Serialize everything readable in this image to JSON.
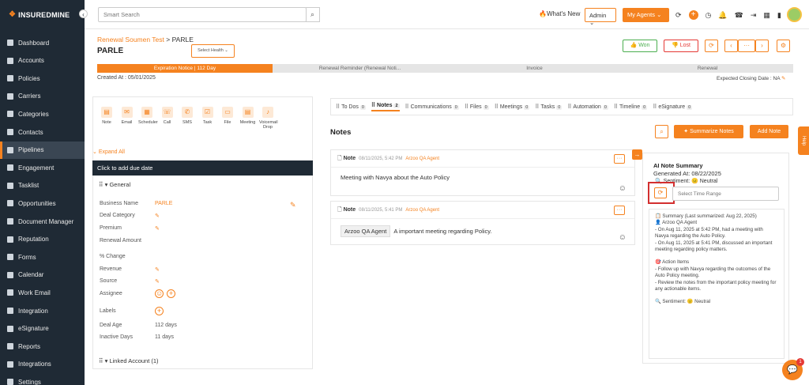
{
  "brand": {
    "name": "INSUREDMINE",
    "accent": "#f5821f"
  },
  "sidebar": {
    "items": [
      {
        "label": "Dashboard",
        "icon": "dashboard-icon"
      },
      {
        "label": "Accounts",
        "icon": "accounts-icon"
      },
      {
        "label": "Policies",
        "icon": "policies-icon"
      },
      {
        "label": "Carriers",
        "icon": "carriers-icon"
      },
      {
        "label": "Categories",
        "icon": "categories-icon"
      },
      {
        "label": "Contacts",
        "icon": "contacts-icon"
      },
      {
        "label": "Pipelines",
        "icon": "pipelines-icon",
        "active": true
      },
      {
        "label": "Engagement",
        "icon": "engagement-icon"
      },
      {
        "label": "Tasklist",
        "icon": "tasklist-icon"
      },
      {
        "label": "Opportunities",
        "icon": "opportunities-icon"
      },
      {
        "label": "Document Manager",
        "icon": "document-icon"
      },
      {
        "label": "Reputation",
        "icon": "reputation-icon"
      },
      {
        "label": "Forms",
        "icon": "forms-icon"
      },
      {
        "label": "Calendar",
        "icon": "calendar-icon"
      },
      {
        "label": "Work Email",
        "icon": "email-icon"
      },
      {
        "label": "Integration",
        "icon": "integration-icon"
      },
      {
        "label": "eSignature",
        "icon": "esignature-icon"
      },
      {
        "label": "Reports",
        "icon": "reports-icon"
      },
      {
        "label": "Integrations",
        "icon": "integrations-icon"
      },
      {
        "label": "Settings",
        "icon": "settings-icon"
      }
    ]
  },
  "topbar": {
    "search_placeholder": "Smart Search",
    "whats_new": "What's New",
    "admin": "Admin",
    "my_agents": "My Agents"
  },
  "header": {
    "breadcrumb_link": "Renewal Soumen Test",
    "breadcrumb_sep": ">",
    "breadcrumb_current": "PARLE",
    "title": "PARLE",
    "select_health": "Select Health",
    "won": "Won",
    "lost": "Lost"
  },
  "stages": [
    "Expiration Notice | 112 Day",
    "Renewal Reminder (Renewal Noti...",
    "Invoice",
    "Renewal"
  ],
  "created": "Created At : 05/01/2025",
  "closing": "Expected Closing Date : NA",
  "actions": [
    "Note",
    "Email",
    "Scheduler",
    "Call",
    "SMS",
    "Task",
    "File",
    "Meeting",
    "Voicemail Drop"
  ],
  "left": {
    "expand_all": "Expand All",
    "due_date": "Click to add due date",
    "general": "General",
    "linked_account": "Linked Account (1)",
    "fields": [
      {
        "label": "Business Name",
        "value": "PARLE"
      },
      {
        "label": "Deal Category",
        "value": ""
      },
      {
        "label": "Premium",
        "value": ""
      },
      {
        "label": "Renewal Amount",
        "value": ""
      },
      {
        "label": "% Change",
        "value": ""
      },
      {
        "label": "Revenue",
        "value": ""
      },
      {
        "label": "Source",
        "value": ""
      },
      {
        "label": "Assignee",
        "value": ""
      },
      {
        "label": "Labels",
        "value": ""
      },
      {
        "label": "Deal Age",
        "value": "112 days"
      },
      {
        "label": "Inactive Days",
        "value": "11 days"
      }
    ]
  },
  "tabs": [
    {
      "label": "To Dos",
      "count": "0"
    },
    {
      "label": "Notes",
      "count": "2"
    },
    {
      "label": "Communications",
      "count": "0"
    },
    {
      "label": "Files",
      "count": "0"
    },
    {
      "label": "Meetings",
      "count": "0"
    },
    {
      "label": "Tasks",
      "count": "0"
    },
    {
      "label": "Automation",
      "count": "0"
    },
    {
      "label": "Timeline",
      "count": "0"
    },
    {
      "label": "eSignature",
      "count": "0"
    }
  ],
  "notes": {
    "title": "Notes",
    "summarize": "Summarize Notes",
    "add": "Add Note",
    "items": [
      {
        "label": "Note",
        "date": "08/11/2025, 5:42 PM",
        "agent": "Arzoo QA Agent",
        "tag": "",
        "text": "Meeting with Navya about the Auto Policy"
      },
      {
        "label": "Note",
        "date": "08/11/2025, 5:41 PM",
        "agent": "Arzoo QA Agent",
        "tag": "Arzoo QA Agent",
        "text": "A important meeting regarding Policy."
      }
    ]
  },
  "ai": {
    "title": "AI Note Summary",
    "generated": "Generated At: 08/22/2025",
    "sentiment": "Sentiment: 😐 Neutral",
    "time_placeholder": "Select Time Range",
    "lines": [
      "📋 Summary (Last summarized: Aug 22, 2025)",
      "👤 Arzoo QA Agent",
      "- On Aug 11, 2025 at 5:42 PM, had a meeting with Navya regarding the Auto Policy.",
      "- On Aug 11, 2025 at 5:41 PM, discussed an important meeting regarding policy matters.",
      "",
      "🎯 Action Items",
      "- Follow up with Navya regarding the outcomes of the Auto Policy meeting.",
      "- Review the notes from the important policy meeting for any actionable items.",
      "",
      "🔍 Sentiment: 😐 Neutral"
    ]
  },
  "help": "Help",
  "chat_badge": "1"
}
